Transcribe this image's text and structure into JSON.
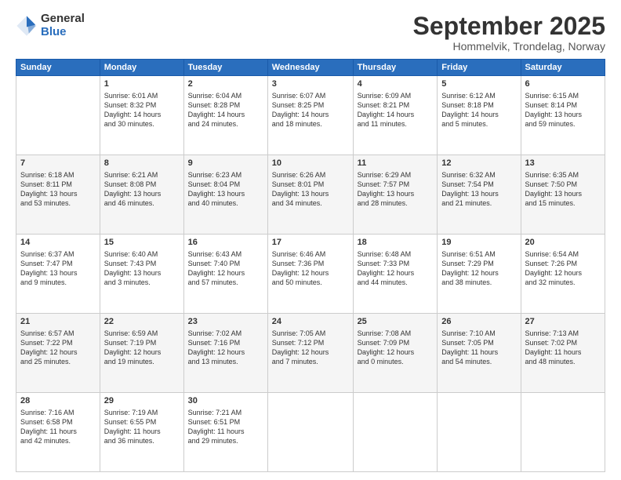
{
  "logo": {
    "general": "General",
    "blue": "Blue"
  },
  "title": "September 2025",
  "location": "Hommelvik, Trondelag, Norway",
  "headers": [
    "Sunday",
    "Monday",
    "Tuesday",
    "Wednesday",
    "Thursday",
    "Friday",
    "Saturday"
  ],
  "weeks": [
    [
      {
        "day": "",
        "lines": []
      },
      {
        "day": "1",
        "lines": [
          "Sunrise: 6:01 AM",
          "Sunset: 8:32 PM",
          "Daylight: 14 hours",
          "and 30 minutes."
        ]
      },
      {
        "day": "2",
        "lines": [
          "Sunrise: 6:04 AM",
          "Sunset: 8:28 PM",
          "Daylight: 14 hours",
          "and 24 minutes."
        ]
      },
      {
        "day": "3",
        "lines": [
          "Sunrise: 6:07 AM",
          "Sunset: 8:25 PM",
          "Daylight: 14 hours",
          "and 18 minutes."
        ]
      },
      {
        "day": "4",
        "lines": [
          "Sunrise: 6:09 AM",
          "Sunset: 8:21 PM",
          "Daylight: 14 hours",
          "and 11 minutes."
        ]
      },
      {
        "day": "5",
        "lines": [
          "Sunrise: 6:12 AM",
          "Sunset: 8:18 PM",
          "Daylight: 14 hours",
          "and 5 minutes."
        ]
      },
      {
        "day": "6",
        "lines": [
          "Sunrise: 6:15 AM",
          "Sunset: 8:14 PM",
          "Daylight: 13 hours",
          "and 59 minutes."
        ]
      }
    ],
    [
      {
        "day": "7",
        "lines": [
          "Sunrise: 6:18 AM",
          "Sunset: 8:11 PM",
          "Daylight: 13 hours",
          "and 53 minutes."
        ]
      },
      {
        "day": "8",
        "lines": [
          "Sunrise: 6:21 AM",
          "Sunset: 8:08 PM",
          "Daylight: 13 hours",
          "and 46 minutes."
        ]
      },
      {
        "day": "9",
        "lines": [
          "Sunrise: 6:23 AM",
          "Sunset: 8:04 PM",
          "Daylight: 13 hours",
          "and 40 minutes."
        ]
      },
      {
        "day": "10",
        "lines": [
          "Sunrise: 6:26 AM",
          "Sunset: 8:01 PM",
          "Daylight: 13 hours",
          "and 34 minutes."
        ]
      },
      {
        "day": "11",
        "lines": [
          "Sunrise: 6:29 AM",
          "Sunset: 7:57 PM",
          "Daylight: 13 hours",
          "and 28 minutes."
        ]
      },
      {
        "day": "12",
        "lines": [
          "Sunrise: 6:32 AM",
          "Sunset: 7:54 PM",
          "Daylight: 13 hours",
          "and 21 minutes."
        ]
      },
      {
        "day": "13",
        "lines": [
          "Sunrise: 6:35 AM",
          "Sunset: 7:50 PM",
          "Daylight: 13 hours",
          "and 15 minutes."
        ]
      }
    ],
    [
      {
        "day": "14",
        "lines": [
          "Sunrise: 6:37 AM",
          "Sunset: 7:47 PM",
          "Daylight: 13 hours",
          "and 9 minutes."
        ]
      },
      {
        "day": "15",
        "lines": [
          "Sunrise: 6:40 AM",
          "Sunset: 7:43 PM",
          "Daylight: 13 hours",
          "and 3 minutes."
        ]
      },
      {
        "day": "16",
        "lines": [
          "Sunrise: 6:43 AM",
          "Sunset: 7:40 PM",
          "Daylight: 12 hours",
          "and 57 minutes."
        ]
      },
      {
        "day": "17",
        "lines": [
          "Sunrise: 6:46 AM",
          "Sunset: 7:36 PM",
          "Daylight: 12 hours",
          "and 50 minutes."
        ]
      },
      {
        "day": "18",
        "lines": [
          "Sunrise: 6:48 AM",
          "Sunset: 7:33 PM",
          "Daylight: 12 hours",
          "and 44 minutes."
        ]
      },
      {
        "day": "19",
        "lines": [
          "Sunrise: 6:51 AM",
          "Sunset: 7:29 PM",
          "Daylight: 12 hours",
          "and 38 minutes."
        ]
      },
      {
        "day": "20",
        "lines": [
          "Sunrise: 6:54 AM",
          "Sunset: 7:26 PM",
          "Daylight: 12 hours",
          "and 32 minutes."
        ]
      }
    ],
    [
      {
        "day": "21",
        "lines": [
          "Sunrise: 6:57 AM",
          "Sunset: 7:22 PM",
          "Daylight: 12 hours",
          "and 25 minutes."
        ]
      },
      {
        "day": "22",
        "lines": [
          "Sunrise: 6:59 AM",
          "Sunset: 7:19 PM",
          "Daylight: 12 hours",
          "and 19 minutes."
        ]
      },
      {
        "day": "23",
        "lines": [
          "Sunrise: 7:02 AM",
          "Sunset: 7:16 PM",
          "Daylight: 12 hours",
          "and 13 minutes."
        ]
      },
      {
        "day": "24",
        "lines": [
          "Sunrise: 7:05 AM",
          "Sunset: 7:12 PM",
          "Daylight: 12 hours",
          "and 7 minutes."
        ]
      },
      {
        "day": "25",
        "lines": [
          "Sunrise: 7:08 AM",
          "Sunset: 7:09 PM",
          "Daylight: 12 hours",
          "and 0 minutes."
        ]
      },
      {
        "day": "26",
        "lines": [
          "Sunrise: 7:10 AM",
          "Sunset: 7:05 PM",
          "Daylight: 11 hours",
          "and 54 minutes."
        ]
      },
      {
        "day": "27",
        "lines": [
          "Sunrise: 7:13 AM",
          "Sunset: 7:02 PM",
          "Daylight: 11 hours",
          "and 48 minutes."
        ]
      }
    ],
    [
      {
        "day": "28",
        "lines": [
          "Sunrise: 7:16 AM",
          "Sunset: 6:58 PM",
          "Daylight: 11 hours",
          "and 42 minutes."
        ]
      },
      {
        "day": "29",
        "lines": [
          "Sunrise: 7:19 AM",
          "Sunset: 6:55 PM",
          "Daylight: 11 hours",
          "and 36 minutes."
        ]
      },
      {
        "day": "30",
        "lines": [
          "Sunrise: 7:21 AM",
          "Sunset: 6:51 PM",
          "Daylight: 11 hours",
          "and 29 minutes."
        ]
      },
      {
        "day": "",
        "lines": []
      },
      {
        "day": "",
        "lines": []
      },
      {
        "day": "",
        "lines": []
      },
      {
        "day": "",
        "lines": []
      }
    ]
  ]
}
